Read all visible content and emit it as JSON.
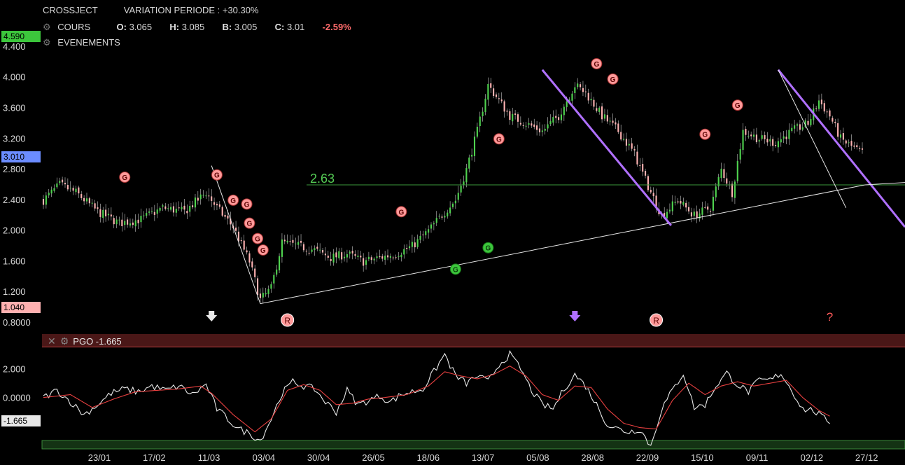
{
  "header": {
    "symbol": "CROSSJECT",
    "variation": "VARIATION PERIODE : +30.30%",
    "cours_label": "COURS",
    "ohlc": [
      {
        "k": "O:",
        "v": "3.065"
      },
      {
        "k": "H:",
        "v": "3.085"
      },
      {
        "k": "B:",
        "v": "3.005"
      },
      {
        "k": "C:",
        "v": "3.01"
      }
    ],
    "change": "-2.59%",
    "events_label": "EVENEMENTS"
  },
  "price_tags": {
    "high": "4.590",
    "last": "3.010",
    "low": "1.040"
  },
  "indicator": {
    "label": "PGO -1.665",
    "last_tag": "-1.665"
  },
  "chart_data": [
    {
      "type": "candlestick",
      "title": "",
      "ylim": [
        0.8,
        4.6
      ],
      "y_ticks": [
        "4.400",
        "4.000",
        "3.600",
        "3.200",
        "2.800",
        "2.400",
        "2.000",
        "1.600",
        "1.200",
        "0.8000"
      ],
      "x_ticks": [
        "23/01",
        "17/02",
        "11/03",
        "03/04",
        "30/04",
        "26/05",
        "18/06",
        "13/07",
        "05/08",
        "28/08",
        "22/09",
        "15/10",
        "09/11",
        "02/12",
        "27/12"
      ],
      "close_path": [
        [
          0,
          2.4
        ],
        [
          6,
          2.6
        ],
        [
          12,
          2.5
        ],
        [
          20,
          2.25
        ],
        [
          28,
          2.1
        ],
        [
          36,
          2.15
        ],
        [
          44,
          2.3
        ],
        [
          52,
          2.25
        ],
        [
          60,
          2.5
        ],
        [
          64,
          2.3
        ],
        [
          70,
          2.05
        ],
        [
          76,
          1.6
        ],
        [
          80,
          1.1
        ],
        [
          84,
          1.25
        ],
        [
          88,
          1.85
        ],
        [
          94,
          1.8
        ],
        [
          100,
          1.75
        ],
        [
          106,
          1.65
        ],
        [
          112,
          1.7
        ],
        [
          118,
          1.6
        ],
        [
          124,
          1.65
        ],
        [
          130,
          1.7
        ],
        [
          136,
          1.8
        ],
        [
          142,
          2.0
        ],
        [
          148,
          2.25
        ],
        [
          152,
          2.4
        ],
        [
          156,
          2.8
        ],
        [
          160,
          3.3
        ],
        [
          164,
          3.9
        ],
        [
          168,
          3.7
        ],
        [
          172,
          3.5
        ],
        [
          178,
          3.4
        ],
        [
          184,
          3.3
        ],
        [
          190,
          3.5
        ],
        [
          196,
          3.9
        ],
        [
          200,
          3.8
        ],
        [
          206,
          3.5
        ],
        [
          212,
          3.3
        ],
        [
          218,
          3.0
        ],
        [
          224,
          2.5
        ],
        [
          228,
          2.2
        ],
        [
          234,
          2.4
        ],
        [
          240,
          2.2
        ],
        [
          246,
          2.3
        ],
        [
          250,
          2.8
        ],
        [
          254,
          2.5
        ],
        [
          258,
          3.3
        ],
        [
          264,
          3.2
        ],
        [
          270,
          3.15
        ],
        [
          276,
          3.3
        ],
        [
          282,
          3.4
        ],
        [
          286,
          3.7
        ],
        [
          290,
          3.5
        ],
        [
          294,
          3.2
        ],
        [
          298,
          3.1
        ],
        [
          302,
          3.01
        ]
      ],
      "n_candles": 303,
      "horizontal_line": {
        "value": 2.6,
        "label": "2.63"
      },
      "trendlines": [
        {
          "from": [
            80,
            1.05
          ],
          "to": [
            303,
            2.6
          ],
          "color": "white"
        },
        {
          "from": [
            62,
            2.85
          ],
          "to": [
            80,
            1.05
          ],
          "color": "white"
        },
        {
          "from": [
            184,
            4.1
          ],
          "to": [
            216,
            2.07
          ],
          "color": "purple"
        },
        {
          "from": [
            271,
            4.1
          ],
          "to": [
            303,
            2.05
          ],
          "color": "purple"
        },
        {
          "from": [
            271,
            4.1
          ],
          "to": [
            296,
            2.3
          ],
          "color": "white"
        }
      ],
      "event_markers": [
        {
          "x": 30,
          "y": 2.7,
          "label": "G",
          "kind": "sell"
        },
        {
          "x": 64,
          "y": 2.73,
          "label": "G",
          "kind": "sell"
        },
        {
          "x": 70,
          "y": 2.4,
          "label": "G",
          "kind": "sell"
        },
        {
          "x": 75,
          "y": 2.35,
          "label": "G",
          "kind": "sell"
        },
        {
          "x": 76,
          "y": 2.1,
          "label": "G",
          "kind": "sell"
        },
        {
          "x": 79,
          "y": 1.9,
          "label": "G",
          "kind": "sell"
        },
        {
          "x": 81,
          "y": 1.75,
          "label": "G",
          "kind": "sell"
        },
        {
          "x": 132,
          "y": 2.25,
          "label": "G",
          "kind": "sell"
        },
        {
          "x": 168,
          "y": 3.2,
          "label": "G",
          "kind": "sell"
        },
        {
          "x": 152,
          "y": 1.5,
          "label": "G",
          "kind": "buy"
        },
        {
          "x": 164,
          "y": 1.78,
          "label": "G",
          "kind": "buy"
        },
        {
          "x": 204,
          "y": 4.18,
          "label": "G",
          "kind": "sell"
        },
        {
          "x": 210,
          "y": 3.98,
          "label": "G",
          "kind": "sell"
        },
        {
          "x": 244,
          "y": 3.26,
          "label": "G",
          "kind": "sell"
        },
        {
          "x": 256,
          "y": 3.64,
          "label": "G",
          "kind": "sell"
        }
      ],
      "bottom_markers": [
        {
          "x": 62,
          "label": "",
          "kind": "arrow-white"
        },
        {
          "x": 90,
          "label": "R",
          "kind": "circle"
        },
        {
          "x": 196,
          "label": "",
          "kind": "arrow-purple"
        },
        {
          "x": 226,
          "label": "R",
          "kind": "circle"
        },
        {
          "x": 290,
          "label": "?",
          "kind": "question"
        }
      ]
    },
    {
      "type": "line",
      "title": "",
      "ylim": [
        -3.0,
        3.5
      ],
      "y_ticks": [
        "2.000",
        "0.0000"
      ],
      "series": [
        {
          "color": "white",
          "path": [
            [
              0,
              0
            ],
            [
              5,
              0.5
            ],
            [
              10,
              -0.3
            ],
            [
              15,
              -1.2
            ],
            [
              20,
              -0.5
            ],
            [
              25,
              0.3
            ],
            [
              30,
              0.6
            ],
            [
              35,
              0.4
            ],
            [
              40,
              0.8
            ],
            [
              45,
              0.5
            ],
            [
              50,
              0.8
            ],
            [
              55,
              0.2
            ],
            [
              60,
              0.9
            ],
            [
              64,
              -0.8
            ],
            [
              68,
              -1.5
            ],
            [
              72,
              -2.2
            ],
            [
              76,
              -2.5
            ],
            [
              80,
              -3.0
            ],
            [
              84,
              -1.5
            ],
            [
              88,
              0.3
            ],
            [
              92,
              1.1
            ],
            [
              96,
              0.8
            ],
            [
              100,
              0.6
            ],
            [
              104,
              -0.3
            ],
            [
              108,
              -1.0
            ],
            [
              112,
              0.5
            ],
            [
              116,
              -0.5
            ],
            [
              120,
              -0.2
            ],
            [
              124,
              0.1
            ],
            [
              128,
              -0.3
            ],
            [
              132,
              0.2
            ],
            [
              136,
              0.4
            ],
            [
              140,
              0.6
            ],
            [
              144,
              1.8
            ],
            [
              148,
              3.0
            ],
            [
              152,
              1.5
            ],
            [
              156,
              1.0
            ],
            [
              160,
              1.5
            ],
            [
              164,
              1.1
            ],
            [
              168,
              2.3
            ],
            [
              172,
              3.0
            ],
            [
              176,
              2.0
            ],
            [
              180,
              0.5
            ],
            [
              184,
              -0.5
            ],
            [
              188,
              -0.8
            ],
            [
              192,
              0.6
            ],
            [
              196,
              1.6
            ],
            [
              200,
              0.8
            ],
            [
              204,
              -0.5
            ],
            [
              208,
              -1.9
            ],
            [
              212,
              -2.2
            ],
            [
              216,
              -2.4
            ],
            [
              220,
              -2.2
            ],
            [
              224,
              -3.4
            ],
            [
              228,
              -0.8
            ],
            [
              232,
              0.5
            ],
            [
              236,
              1.7
            ],
            [
              240,
              -0.7
            ],
            [
              244,
              -0.5
            ],
            [
              248,
              0.8
            ],
            [
              252,
              1.7
            ],
            [
              256,
              0.9
            ],
            [
              260,
              0.4
            ],
            [
              264,
              1.2
            ],
            [
              268,
              1.2
            ],
            [
              272,
              1.7
            ],
            [
              276,
              0.5
            ],
            [
              280,
              -0.8
            ],
            [
              284,
              -0.9
            ],
            [
              288,
              -1.5
            ],
            [
              290,
              -1.665
            ]
          ]
        },
        {
          "color": "red",
          "path": [
            [
              0,
              0
            ],
            [
              10,
              0.2
            ],
            [
              18,
              -0.7
            ],
            [
              26,
              -0.1
            ],
            [
              34,
              0.4
            ],
            [
              42,
              0.5
            ],
            [
              50,
              0.6
            ],
            [
              58,
              0.8
            ],
            [
              62,
              0.3
            ],
            [
              70,
              -1.2
            ],
            [
              78,
              -2.4
            ],
            [
              84,
              -1.5
            ],
            [
              90,
              0.5
            ],
            [
              96,
              0.9
            ],
            [
              102,
              0.5
            ],
            [
              108,
              -0.5
            ],
            [
              114,
              -0.4
            ],
            [
              120,
              -0.1
            ],
            [
              126,
              0.0
            ],
            [
              134,
              0.2
            ],
            [
              142,
              0.8
            ],
            [
              148,
              1.8
            ],
            [
              154,
              1.5
            ],
            [
              160,
              1.3
            ],
            [
              166,
              1.6
            ],
            [
              172,
              2.2
            ],
            [
              178,
              1.5
            ],
            [
              184,
              0.2
            ],
            [
              190,
              -0.2
            ],
            [
              196,
              0.8
            ],
            [
              202,
              0.7
            ],
            [
              208,
              -0.8
            ],
            [
              214,
              -1.8
            ],
            [
              220,
              -2.1
            ],
            [
              226,
              -2.2
            ],
            [
              232,
              -0.2
            ],
            [
              238,
              1.0
            ],
            [
              244,
              0.2
            ],
            [
              250,
              0.8
            ],
            [
              256,
              1.1
            ],
            [
              262,
              0.8
            ],
            [
              268,
              1.0
            ],
            [
              274,
              1.2
            ],
            [
              280,
              0.0
            ],
            [
              286,
              -0.9
            ],
            [
              290,
              -1.3
            ]
          ]
        }
      ]
    }
  ]
}
